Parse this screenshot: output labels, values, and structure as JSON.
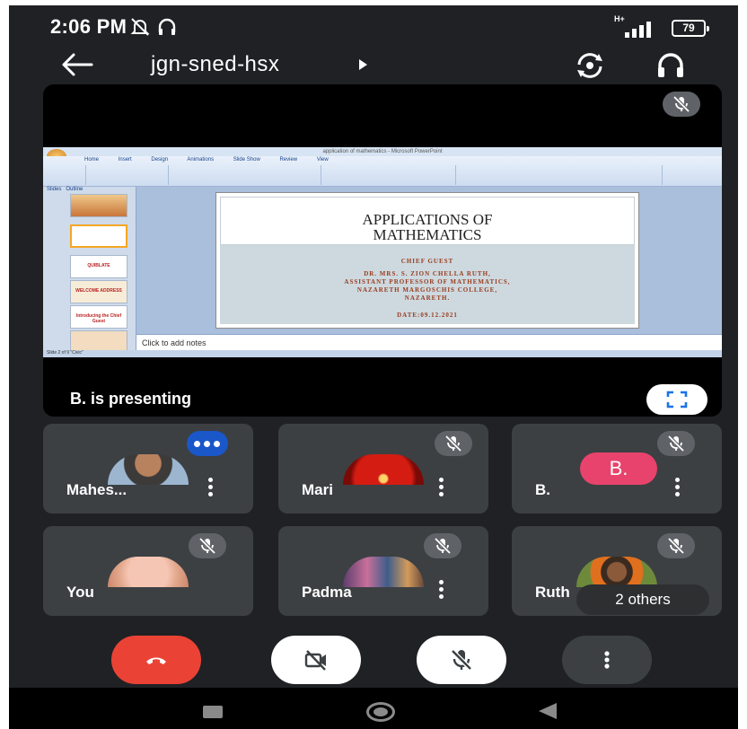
{
  "status_bar": {
    "time": "2:06 PM",
    "network": "H+",
    "battery": "79"
  },
  "top_bar": {
    "meeting_code": "jgn-sned-hsx"
  },
  "presentation": {
    "presenter_label": "B. is presenting",
    "window_title": "application of mathematics - Microsoft PowerPoint",
    "ribbon_tabs": [
      "Home",
      "Insert",
      "Design",
      "Animations",
      "Slide Show",
      "Review",
      "View"
    ],
    "panel_tabs": [
      "Slides",
      "Outline"
    ],
    "slide": {
      "title_line1": "APPLICATIONS OF",
      "title_line2": "MATHEMATICS",
      "chief_guest": "CHIEF GUEST",
      "line1": "DR. MRS. S. ZION CHELLA RUTH,",
      "line2": "ASSISTANT PROFESSOR OF MATHEMATICS,",
      "line3": "NAZARETH MARGOSCHIS COLLEGE,",
      "line4": "NAZARETH.",
      "date": "DATE:09.12.2021"
    },
    "thumbnails": [
      "",
      "",
      "QUIBLATE",
      "WELCOME ADDRESS",
      "Introducing the Chief Guest",
      ""
    ],
    "notes_placeholder": "Click to add notes",
    "status_text": "Slide 2 of 9   \"Civic\""
  },
  "participants": [
    {
      "name": "Mahes...",
      "avatar": "boy-photo",
      "speaking": true
    },
    {
      "name": "Mari",
      "avatar": "red-flower-photo",
      "muted": true
    },
    {
      "name": "B.",
      "avatar_letter": "B.",
      "avatar_color": "#e8436c",
      "muted": true
    },
    {
      "name": "You",
      "avatar": "baby-photo",
      "muted": true
    },
    {
      "name": "Padma",
      "avatar": "group-photo",
      "muted": true
    },
    {
      "name": "Ruth",
      "avatar": "woman-photo",
      "muted": true
    }
  ],
  "others_pill": "2 others",
  "colors": {
    "background": "#202124",
    "tile": "#3c4043",
    "end_call": "#ea4335",
    "speaking_badge": "#1a57c9"
  }
}
